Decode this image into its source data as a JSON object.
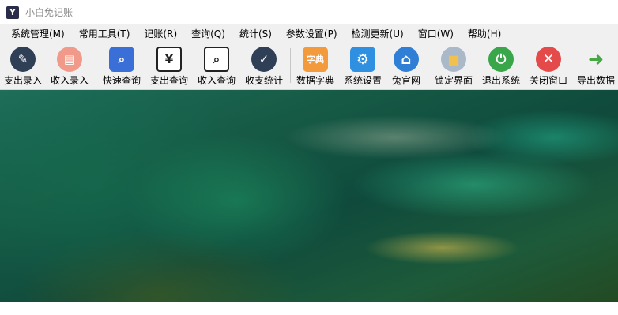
{
  "window": {
    "title": "小白免记账",
    "app_icon": "app-logo-icon"
  },
  "menu": [
    "系统管理(M)",
    "常用工具(T)",
    "记账(R)",
    "查询(Q)",
    "统计(S)",
    "参数设置(P)",
    "检测更新(U)",
    "窗口(W)",
    "帮助(H)"
  ],
  "toolbar": [
    {
      "label": "支出录入",
      "icon": "expense-entry-icon",
      "color": "#2f3f55",
      "glyph": "✎"
    },
    {
      "label": "收入录入",
      "icon": "income-entry-icon",
      "color": "#f29a8a",
      "glyph": "▤"
    },
    {
      "label": "快速查询",
      "icon": "quick-search-icon",
      "color": "#3a6fd8",
      "glyph": "🔍"
    },
    {
      "label": "支出查询",
      "icon": "expense-query-icon",
      "color": "#ffffff",
      "glyph": "¥"
    },
    {
      "label": "收入查询",
      "icon": "income-query-icon",
      "color": "#ffffff",
      "glyph": "⌕"
    },
    {
      "label": "收支统计",
      "icon": "statistics-icon",
      "color": "#2f3f55",
      "glyph": "✓"
    },
    {
      "label": "数据字典",
      "icon": "data-dictionary-icon",
      "color": "#f39a3c",
      "glyph": "字典"
    },
    {
      "label": "系统设置",
      "icon": "settings-gear-icon",
      "color": "#2f8fe0",
      "glyph": "⚙"
    },
    {
      "label": "兔官网",
      "icon": "home-website-icon",
      "color": "#2f7fd6",
      "glyph": "⌂"
    },
    {
      "label": "锁定界面",
      "icon": "lock-icon",
      "color": "#a9b9c9",
      "glyph": "🔒"
    },
    {
      "label": "退出系统",
      "icon": "power-icon",
      "color": "#3aa64a",
      "glyph": "⏻"
    },
    {
      "label": "关闭窗口",
      "icon": "close-icon",
      "color": "#e44a4a",
      "glyph": "✕"
    },
    {
      "label": "导出数据",
      "icon": "export-arrow-icon",
      "color": "#45a845",
      "glyph": "➜"
    }
  ]
}
